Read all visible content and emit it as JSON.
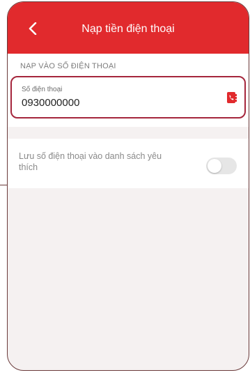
{
  "header": {
    "title": "Nạp tiền điện thoại",
    "back_icon": "chevron-left-icon"
  },
  "topup_section": {
    "label": "NẠP VÀO SỐ ĐIỆN THOẠI",
    "phone_field": {
      "label": "Số điện thoại",
      "value": "0930000000",
      "contacts_icon": "phone-book-icon"
    }
  },
  "favorite": {
    "label": "Lưu số điện thoại vào danh sách yêu thích",
    "enabled": false
  },
  "colors": {
    "brand_red": "#e12a2d",
    "field_border": "#a5263c",
    "background": "#f5f1f1"
  }
}
